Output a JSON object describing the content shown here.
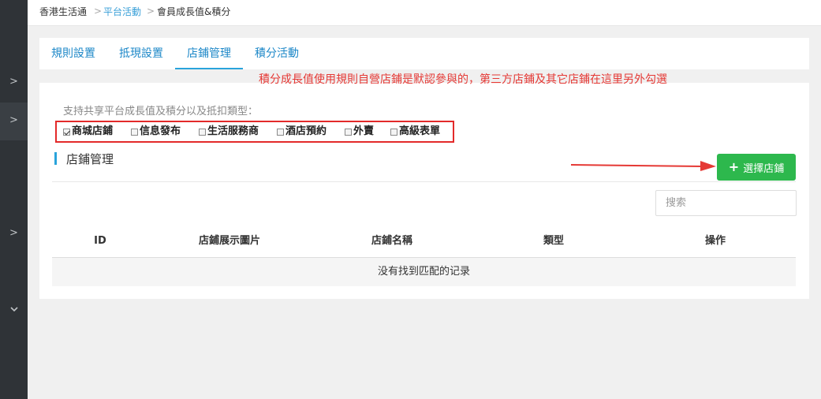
{
  "breadcrumb": {
    "home": "香港生活通",
    "parent": "平台活動",
    "current": "會員成長值&積分",
    "separator": ">"
  },
  "sidebar": {
    "chevrons": [
      ">",
      ">",
      ">",
      "v"
    ]
  },
  "tabs": [
    {
      "label": "規則設置",
      "active": false
    },
    {
      "label": "抵現設置",
      "active": false
    },
    {
      "label": "店鋪管理",
      "active": true
    },
    {
      "label": "積分活動",
      "active": false
    }
  ],
  "annotation": "積分成長值使用規則自營店鋪是默認參與的，第三方店鋪及其它店鋪在這里另外勾選",
  "support": {
    "label": "支持共享平台成長值及積分以及抵扣類型：",
    "options": [
      {
        "label": "商城店鋪",
        "checked": true
      },
      {
        "label": "信息發布",
        "checked": false
      },
      {
        "label": "生活服務商",
        "checked": false
      },
      {
        "label": "酒店預約",
        "checked": false
      },
      {
        "label": "外賣",
        "checked": false
      },
      {
        "label": "高級表單",
        "checked": false
      }
    ]
  },
  "section": {
    "title": "店鋪管理",
    "select_button": "選擇店鋪",
    "plus_icon": "plus-icon"
  },
  "search": {
    "placeholder": "搜索"
  },
  "table": {
    "columns": [
      "ID",
      "店鋪展示圖片",
      "店鋪名稱",
      "類型",
      "操作"
    ],
    "empty_message": "没有找到匹配的记录"
  },
  "colors": {
    "accent": "#29a3db",
    "primary_button": "#2db84d",
    "annotation": "#e53935",
    "sidebar": "#2f3337"
  }
}
